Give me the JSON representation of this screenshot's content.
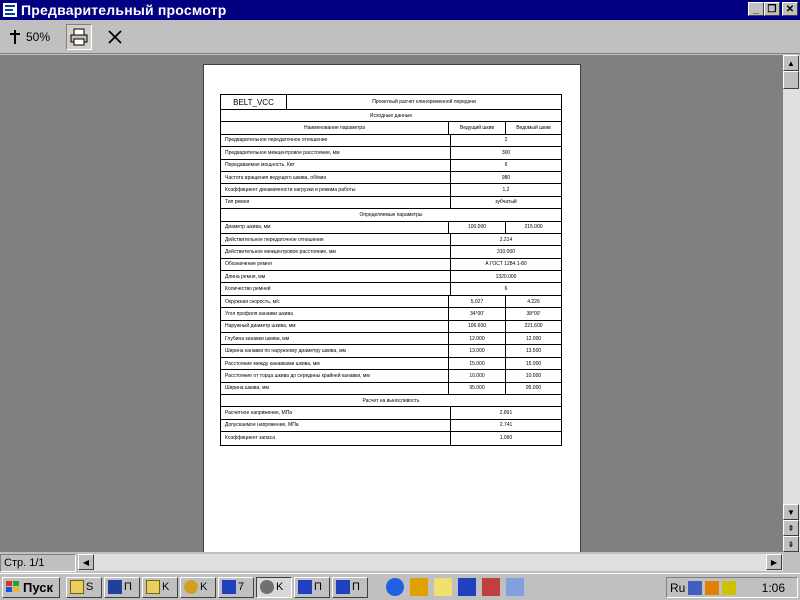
{
  "window": {
    "title": "Предварительный просмотр"
  },
  "toolbar": {
    "zoom": "50%"
  },
  "statusbar": {
    "page": "Стр. 1/1"
  },
  "report": {
    "code": "BELT_VCC",
    "header_title": "Проектный расчет клиноременной передачи",
    "sections": [
      {
        "title": "Исходные данные"
      },
      {
        "title": "Определяемые параметры"
      },
      {
        "title": "Расчет на выносливость"
      }
    ],
    "input_header": {
      "name": "Наименование параметра",
      "col1": "Ведущий шкив",
      "col2": "Ведомый шкив"
    },
    "inputs": [
      {
        "name": "Предварительное передаточное отношение",
        "value": "2"
      },
      {
        "name": "Предварительное межцентровое расстояние, мм",
        "value": "300"
      },
      {
        "name": "Передаваемая мощность, Квт",
        "value": "6"
      },
      {
        "name": "Частота вращения ведущего шкива, об/мин",
        "value": "980"
      },
      {
        "name": "Коэффициент динамичности нагрузки и режима работы",
        "value": "1,2"
      },
      {
        "name": "Тип ремня",
        "value": "зубчатый"
      }
    ],
    "params": [
      {
        "name": "Диаметр шкива, мм",
        "v1": "100.000",
        "v2": "215.000"
      },
      {
        "name": "Действительное передаточное отношение",
        "value": "2.214"
      },
      {
        "name": "Действительное межцентровое расстояние, мм",
        "value": "310.000"
      },
      {
        "name": "Обозначение ремня",
        "value": "А ГОСТ 1284.1-80"
      },
      {
        "name": "Длина ремня, мм",
        "value": "1320.000"
      },
      {
        "name": "Количество ремней",
        "value": "6"
      },
      {
        "name": "Окружная скорость, м/с",
        "v1": "5.027",
        "v2": "4.226"
      },
      {
        "name": "Угол профиля канавки шкива",
        "v1": "34°00'",
        "v2": "38°00'"
      },
      {
        "name": "Наружный диаметр шкива, мм",
        "v1": "106.600",
        "v2": "221.600"
      },
      {
        "name": "Глубина канавки шкива, мм",
        "v1": "12.000",
        "v2": "12.000"
      },
      {
        "name": "Ширина канавки по наружному диаметру шкива, мм",
        "v1": "13.000",
        "v2": "13.500"
      },
      {
        "name": "Расстояние между канавками шкива, мм",
        "v1": "15.000",
        "v2": "15.000"
      },
      {
        "name": "Расстояние от торца шкива до середины крайней канавки, мм",
        "v1": "10.000",
        "v2": "10.000"
      },
      {
        "name": "Ширина шкива, мм",
        "v1": "95.000",
        "v2": "95.000"
      }
    ],
    "strength": [
      {
        "name": "Расчетное напряжение, МПа",
        "value": "2.891"
      },
      {
        "name": "Допускаемое напряжение, МПа",
        "value": "2.741"
      },
      {
        "name": "Коэффициент запаса",
        "value": "1.090"
      }
    ]
  },
  "taskbar": {
    "start_label": "Пуск",
    "tasks": [
      {
        "label": "S"
      },
      {
        "label": "П"
      },
      {
        "label": "K"
      },
      {
        "label": "K"
      },
      {
        "label": "7"
      },
      {
        "label": "K"
      },
      {
        "label": "П"
      },
      {
        "label": "П"
      }
    ],
    "lang": "Ru",
    "clock": "1:06"
  },
  "colors": {
    "titlebar": "#000080",
    "face": "#c0c0c0",
    "workspace": "#808080"
  }
}
